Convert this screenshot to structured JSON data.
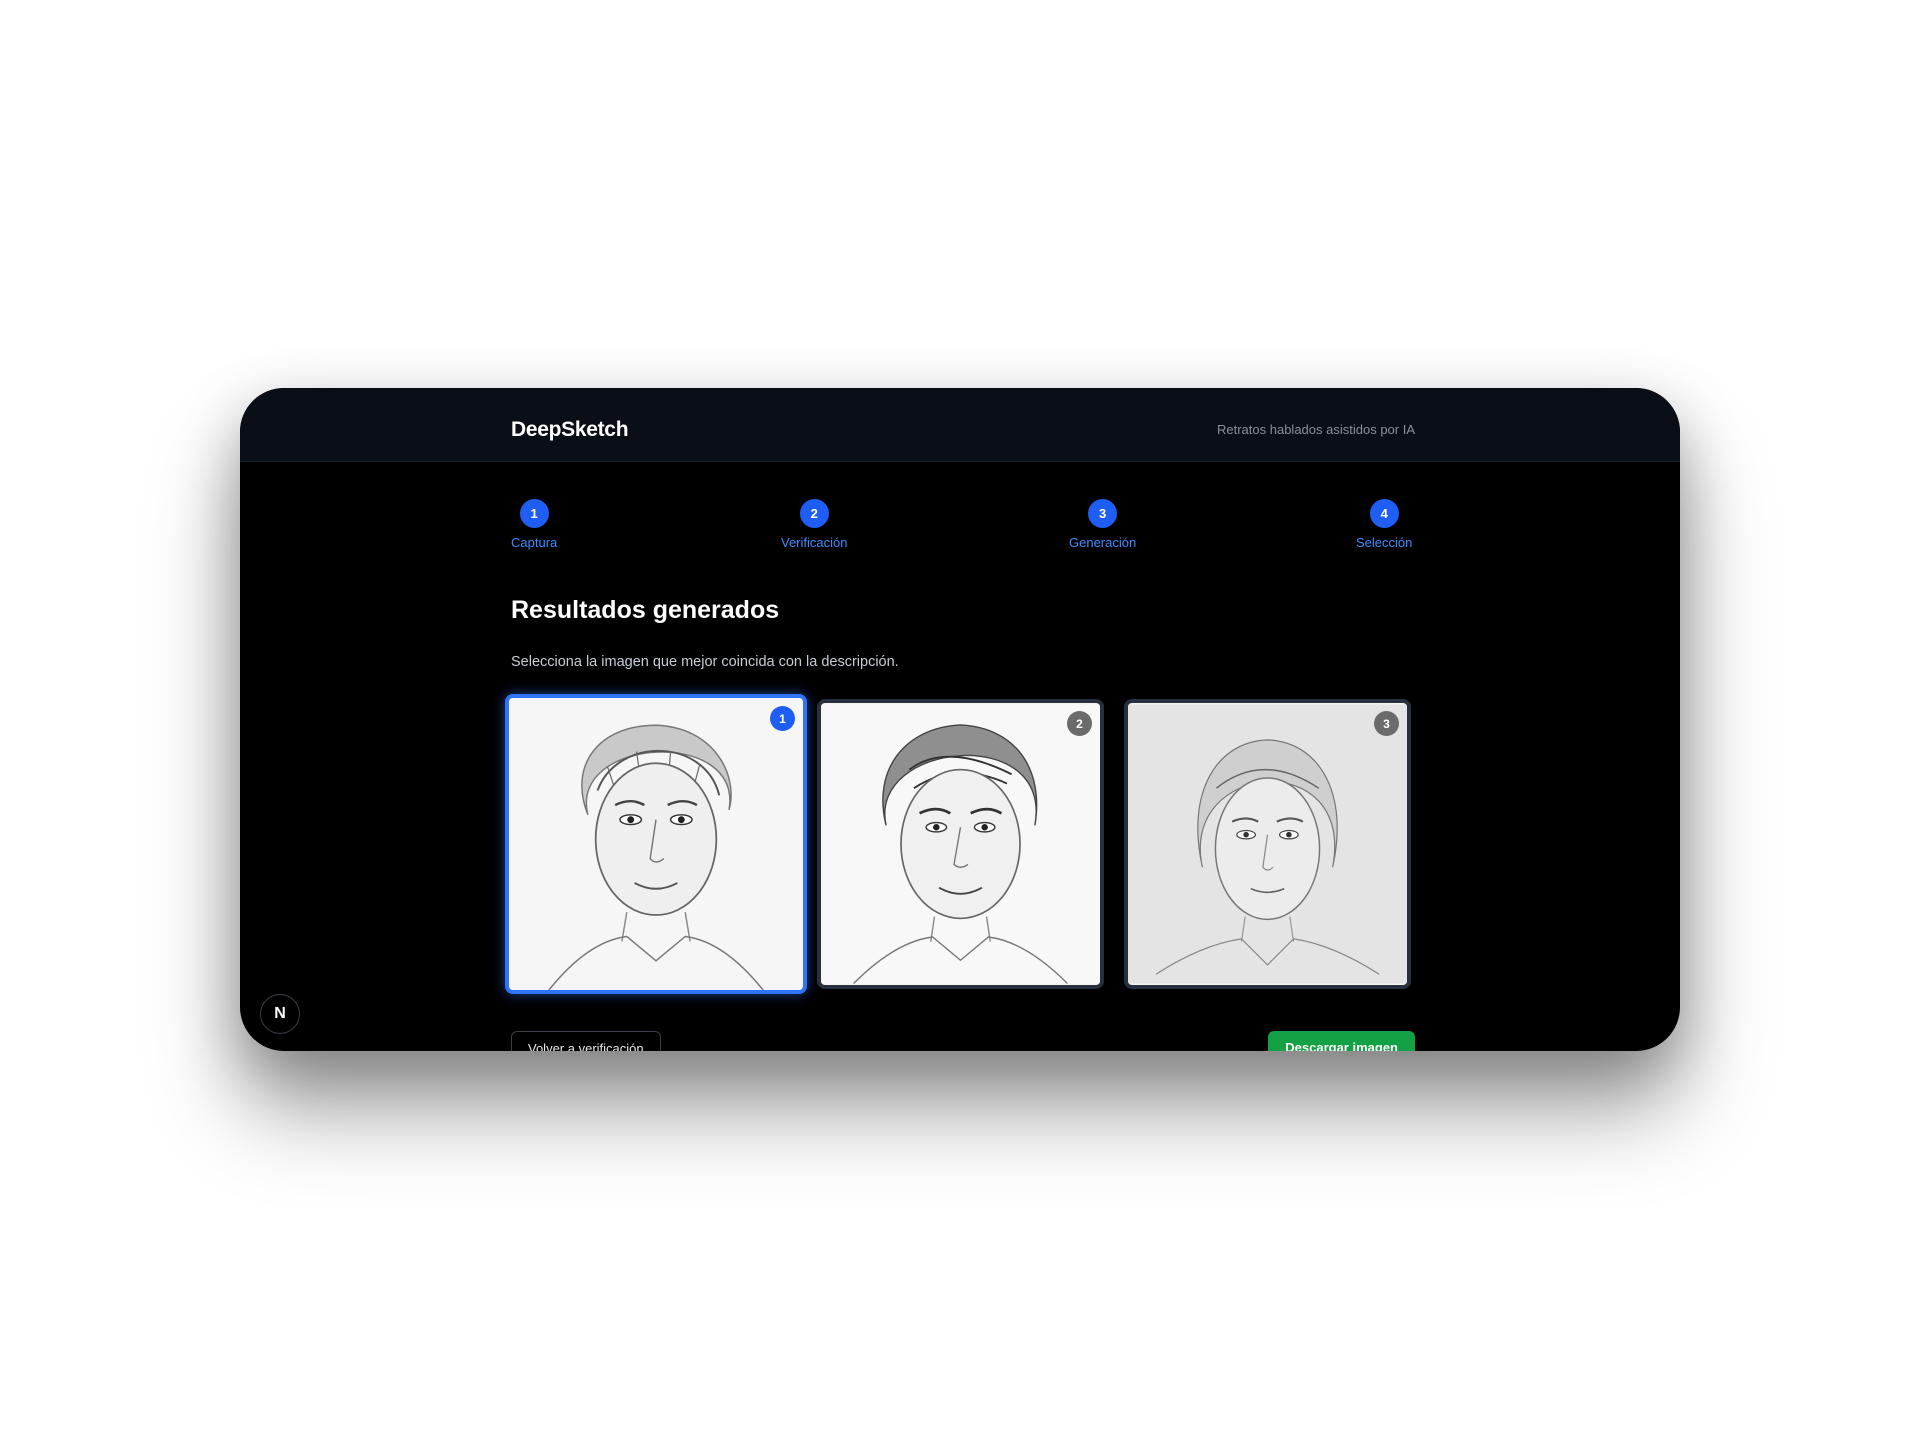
{
  "app": {
    "brand": "DeepSketch",
    "tagline": "Retratos hablados asistidos por IA"
  },
  "steps": [
    {
      "number": "1",
      "label": "Captura"
    },
    {
      "number": "2",
      "label": "Verificación"
    },
    {
      "number": "3",
      "label": "Generación"
    },
    {
      "number": "4",
      "label": "Selección"
    }
  ],
  "results": {
    "title": "Resultados generados",
    "instruction": "Selecciona la imagen que mejor coincida con la descripción.",
    "images": [
      {
        "badge": "1",
        "selected": true,
        "description": "pencil-sketch-portrait-man-tousled-hair"
      },
      {
        "badge": "2",
        "selected": false,
        "description": "pencil-sketch-portrait-man-swept-hair"
      },
      {
        "badge": "3",
        "selected": false,
        "description": "pencil-sketch-portrait-man-medium-hair"
      }
    ]
  },
  "actions": {
    "back_label": "Volver a verificación",
    "download_label": "Descargar imagen"
  },
  "dev_indicator": {
    "label": "N"
  },
  "colors": {
    "accent": "#1f5ef5",
    "step_label": "#3d8bff",
    "download": "#14a145",
    "background": "#000000",
    "header": "#0a0e16"
  }
}
